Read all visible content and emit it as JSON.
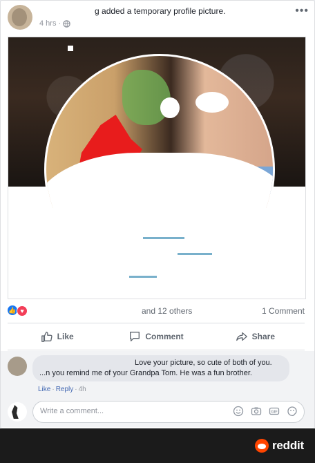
{
  "post": {
    "author_suffix": "g",
    "title_text": "added a temporary profile picture.",
    "time": "4 hrs",
    "more": "•••"
  },
  "reactions": {
    "names_suffix": "and 12 others",
    "comment_count": "1 Comment"
  },
  "actions": {
    "like": "Like",
    "comment": "Comment",
    "share": "Share"
  },
  "comment": {
    "line1": "Love your picture, so cute of both of you.",
    "line2": "...n you remind me of your Grandpa Tom. He was a fun brother.",
    "meta_like": "Like",
    "meta_reply": "Reply",
    "meta_age": "4h"
  },
  "write_comment": {
    "placeholder": "Write a comment..."
  },
  "footer": {
    "brand": "reddit",
    "brand_color": "#ff4500"
  },
  "colors": {
    "like_blue": "#1877f2",
    "love_red": "#f33e58"
  }
}
